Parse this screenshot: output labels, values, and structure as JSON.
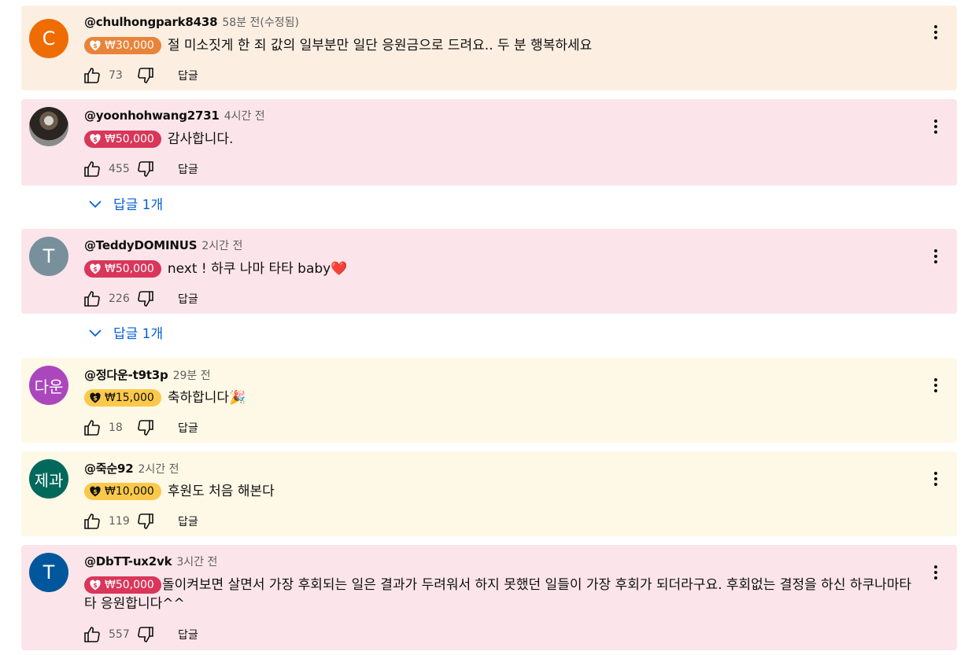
{
  "colors": {
    "bg_orange": "#fcefe2",
    "bg_pink": "#fbe5ea",
    "bg_yellow": "#fef8e6",
    "chip_orange": "#e8833a",
    "chip_pink": "#d9365a",
    "chip_yellow": "#fbc94a",
    "link_blue": "#065fd4"
  },
  "comments": [
    {
      "avatar_letter": "C",
      "avatar_color": "#ef6c00",
      "author": "@chulhongpark8438",
      "time": "58분 전(수정됨)",
      "amount": "₩30,000",
      "text": "절 미소짓게 한 죄 값의 일부분만 일단 응원금으로 드려요.. 두 분 행복하세요",
      "likes": "73",
      "reply_label": "답글"
    },
    {
      "avatar_letter": "",
      "avatar_color": "",
      "author": "@yoonhohwang2731",
      "time": "4시간 전",
      "amount": "₩50,000",
      "text": "감사합니다.",
      "likes": "455",
      "reply_label": "답글",
      "replies_label": "답글 1개"
    },
    {
      "avatar_letter": "T",
      "avatar_color": "#78909c",
      "author": "@TeddyDOMINUS",
      "time": "2시간 전",
      "amount": "₩50,000",
      "text": "next ! 하쿠 나마 타타  baby❤️",
      "likes": "226",
      "reply_label": "답글",
      "replies_label": "답글 1개"
    },
    {
      "avatar_letter": "다운",
      "avatar_color": "#ab47bc",
      "author": "@정다운-t9t3p",
      "time": "29분 전",
      "amount": "₩15,000",
      "text": "축하합니다🎉",
      "likes": "18",
      "reply_label": "답글"
    },
    {
      "avatar_letter": "제과",
      "avatar_color": "#00695c",
      "author": "@죽순92",
      "time": "2시간 전",
      "amount": "₩10,000",
      "text": "후원도 처음 해본다",
      "likes": "119",
      "reply_label": "답글"
    },
    {
      "avatar_letter": "T",
      "avatar_color": "#01579b",
      "author": "@DbTT-ux2vk",
      "time": "3시간 전",
      "amount": "₩50,000",
      "text": "돌이켜보면 살면서 가장 후회되는 일은 결과가 두려워서 하지 못했던 일들이 가장 후회가 되더라구요. 후회없는 결정을 하신 하쿠나마타타 응원합니다^^",
      "likes": "557",
      "reply_label": "답글"
    }
  ]
}
